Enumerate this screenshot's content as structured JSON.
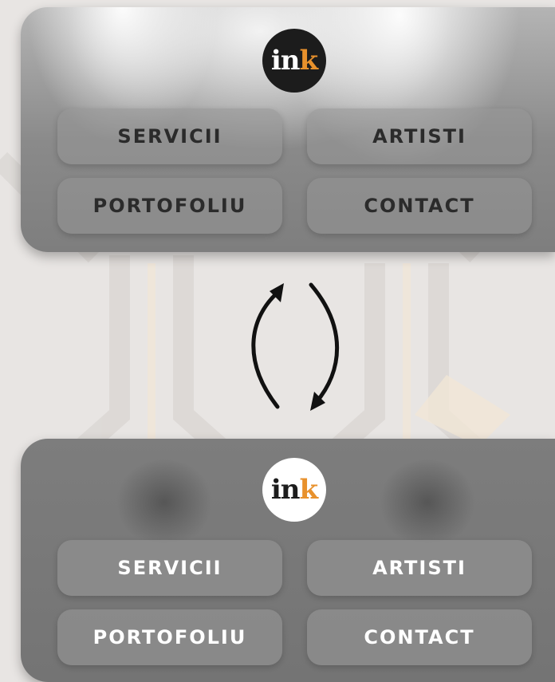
{
  "logo": {
    "main": "in",
    "accent": "k",
    "accent_color": "#e8912c"
  },
  "top_menu": {
    "theme": "light",
    "logo_background": "#1c1c1c",
    "text_color": "#2b2b2b",
    "buttons": [
      {
        "label": "SERVICII"
      },
      {
        "label": "ARTISTI"
      },
      {
        "label": "PORTOFOLIU"
      },
      {
        "label": "CONTACT"
      }
    ]
  },
  "bottom_menu": {
    "theme": "dark",
    "logo_background": "#ffffff",
    "text_color": "#ffffff",
    "buttons": [
      {
        "label": "SERVICII"
      },
      {
        "label": "ARTISTI"
      },
      {
        "label": "PORTOFOLIU"
      },
      {
        "label": "CONTACT"
      }
    ]
  },
  "transition_icon": "swap-arrows-icon"
}
